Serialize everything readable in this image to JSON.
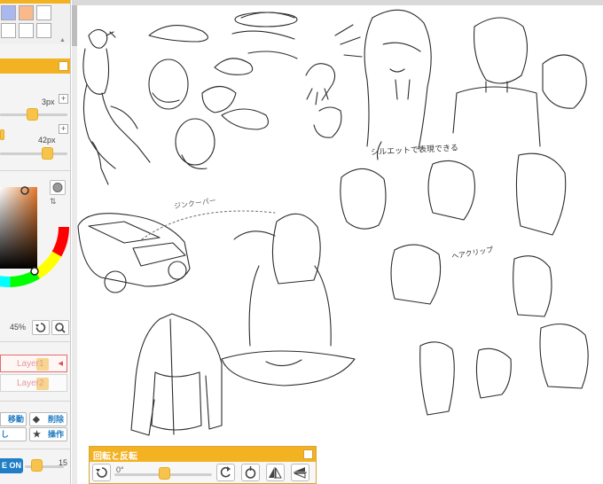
{
  "panels": {
    "brush_size_value": "3px",
    "opacity_value": "42px",
    "color_zoom_value": "45%",
    "plus": "+",
    "layers": [
      {
        "name": "Layer1",
        "active": true
      },
      {
        "name": "Layer2",
        "active": false
      }
    ],
    "tool_buttons": {
      "move_label": "移動",
      "delete_label": "削除",
      "partial_label": "し",
      "operation_label": "操作"
    },
    "bottom": {
      "toggle_label": "E ON",
      "number": "15"
    }
  },
  "rotate_panel": {
    "title": "回転と反転",
    "angle": "0°"
  },
  "sketch_notes": {
    "note_1": "シルエットで表現できる",
    "note_2": "ジンクーパー",
    "note_3": "ヘアクリップ"
  },
  "colors": {
    "accent": "#f3b222",
    "accent_dark": "#e6ab23",
    "button_blue": "#1f7ec6",
    "layer_active": "#e36b6b"
  }
}
